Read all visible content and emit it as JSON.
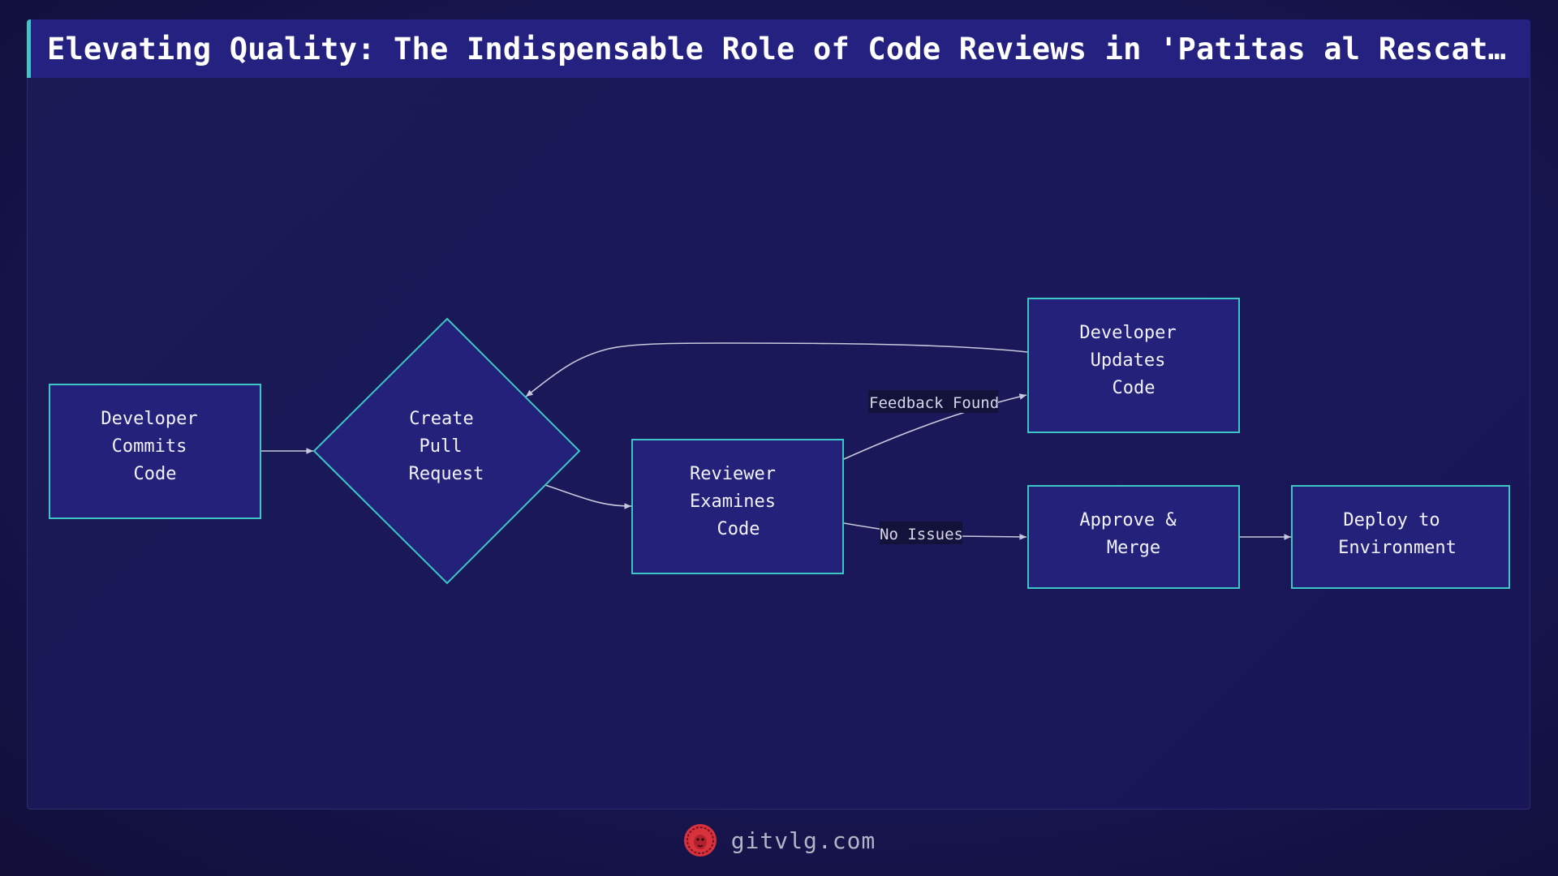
{
  "title": "Elevating Quality: The Indispensable Role of Code Reviews in 'Patitas al Rescat…",
  "nodes": {
    "commit": [
      "Developer",
      "Commits",
      "Code"
    ],
    "pull_request": [
      "Create",
      "Pull",
      "Request"
    ],
    "review": [
      "Reviewer",
      "Examines",
      "Code"
    ],
    "update": [
      "Developer",
      "Updates",
      "Code"
    ],
    "approve": [
      "Approve &",
      "Merge"
    ],
    "deploy": [
      "Deploy to",
      "Environment"
    ]
  },
  "edges": {
    "feedback_label": "Feedback Found",
    "no_issues_label": "No Issues"
  },
  "footer": {
    "site": "gitvlg.com",
    "logo_icon": "lion-icon"
  },
  "colors": {
    "node_fill": "#23217a",
    "node_stroke": "#3ec6c6",
    "edge": "#c8c8dc",
    "accent": "#3ec6c6",
    "label_bg": "#13123a",
    "logo": "#d8323c"
  }
}
